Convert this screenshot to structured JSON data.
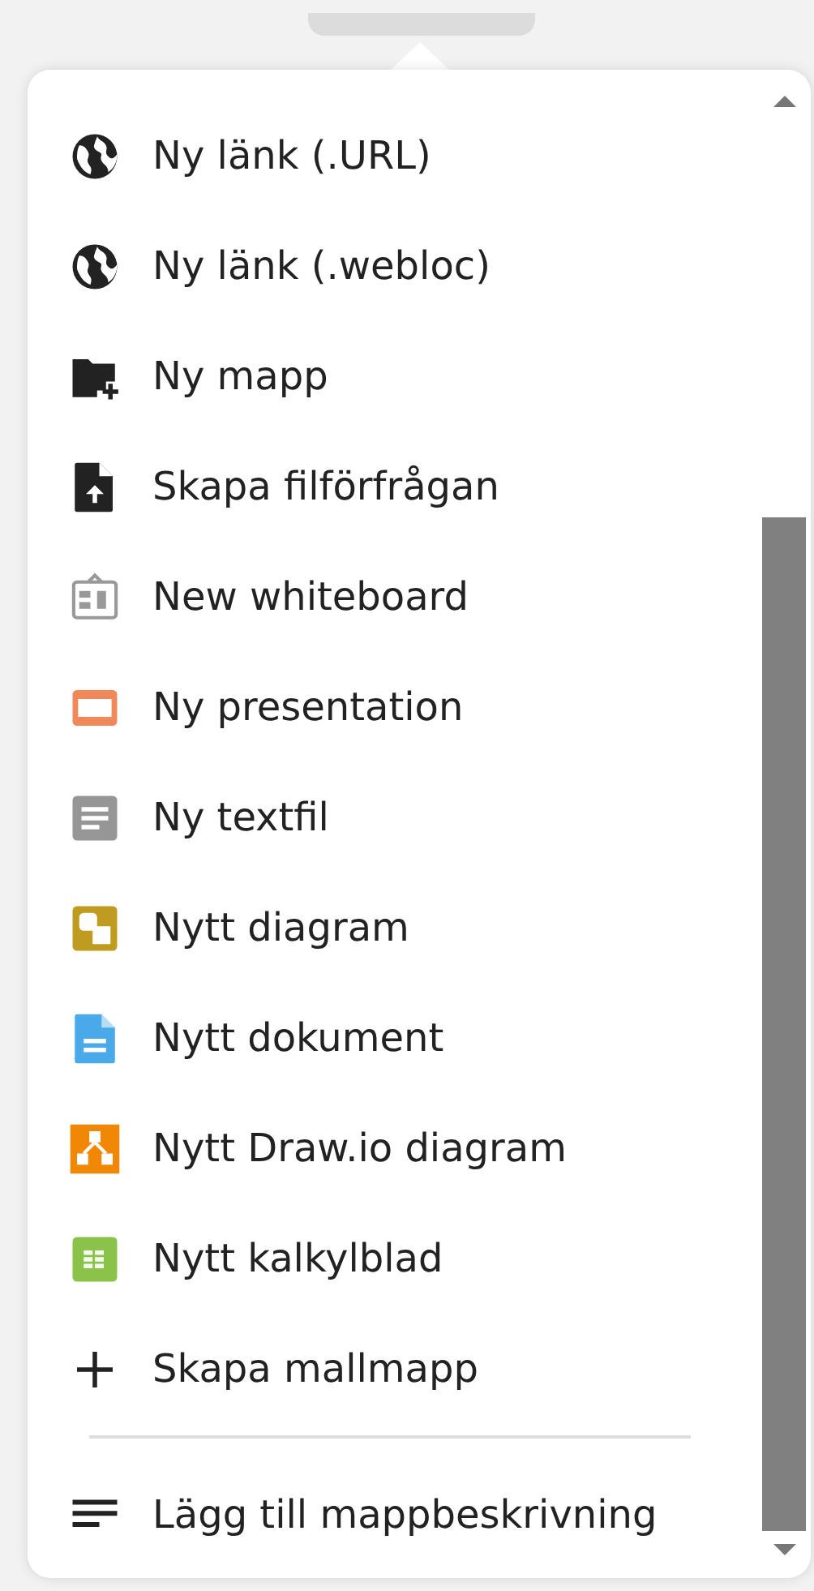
{
  "menu": {
    "sections": [
      {
        "items": [
          {
            "kind": "globe",
            "label": "Ny länk (.URL)"
          },
          {
            "kind": "globe",
            "label": "Ny länk (.webloc)"
          },
          {
            "kind": "folder-plus",
            "label": "Ny mapp"
          },
          {
            "kind": "file-upload",
            "label": "Skapa filförfrågan"
          },
          {
            "kind": "whiteboard",
            "label": "New whiteboard"
          },
          {
            "kind": "presentation",
            "label": "Ny presentation"
          },
          {
            "kind": "textfile",
            "label": "Ny textfil"
          },
          {
            "kind": "diagram",
            "label": "Nytt diagram"
          },
          {
            "kind": "document",
            "label": "Nytt dokument"
          },
          {
            "kind": "drawio",
            "label": "Nytt Draw.io diagram"
          },
          {
            "kind": "spreadsheet",
            "label": "Nytt kalkylblad"
          },
          {
            "kind": "plus",
            "label": "Skapa mallmapp"
          }
        ]
      },
      {
        "items": [
          {
            "kind": "description",
            "label": "Lägg till mappbeskrivning"
          }
        ]
      }
    ]
  }
}
